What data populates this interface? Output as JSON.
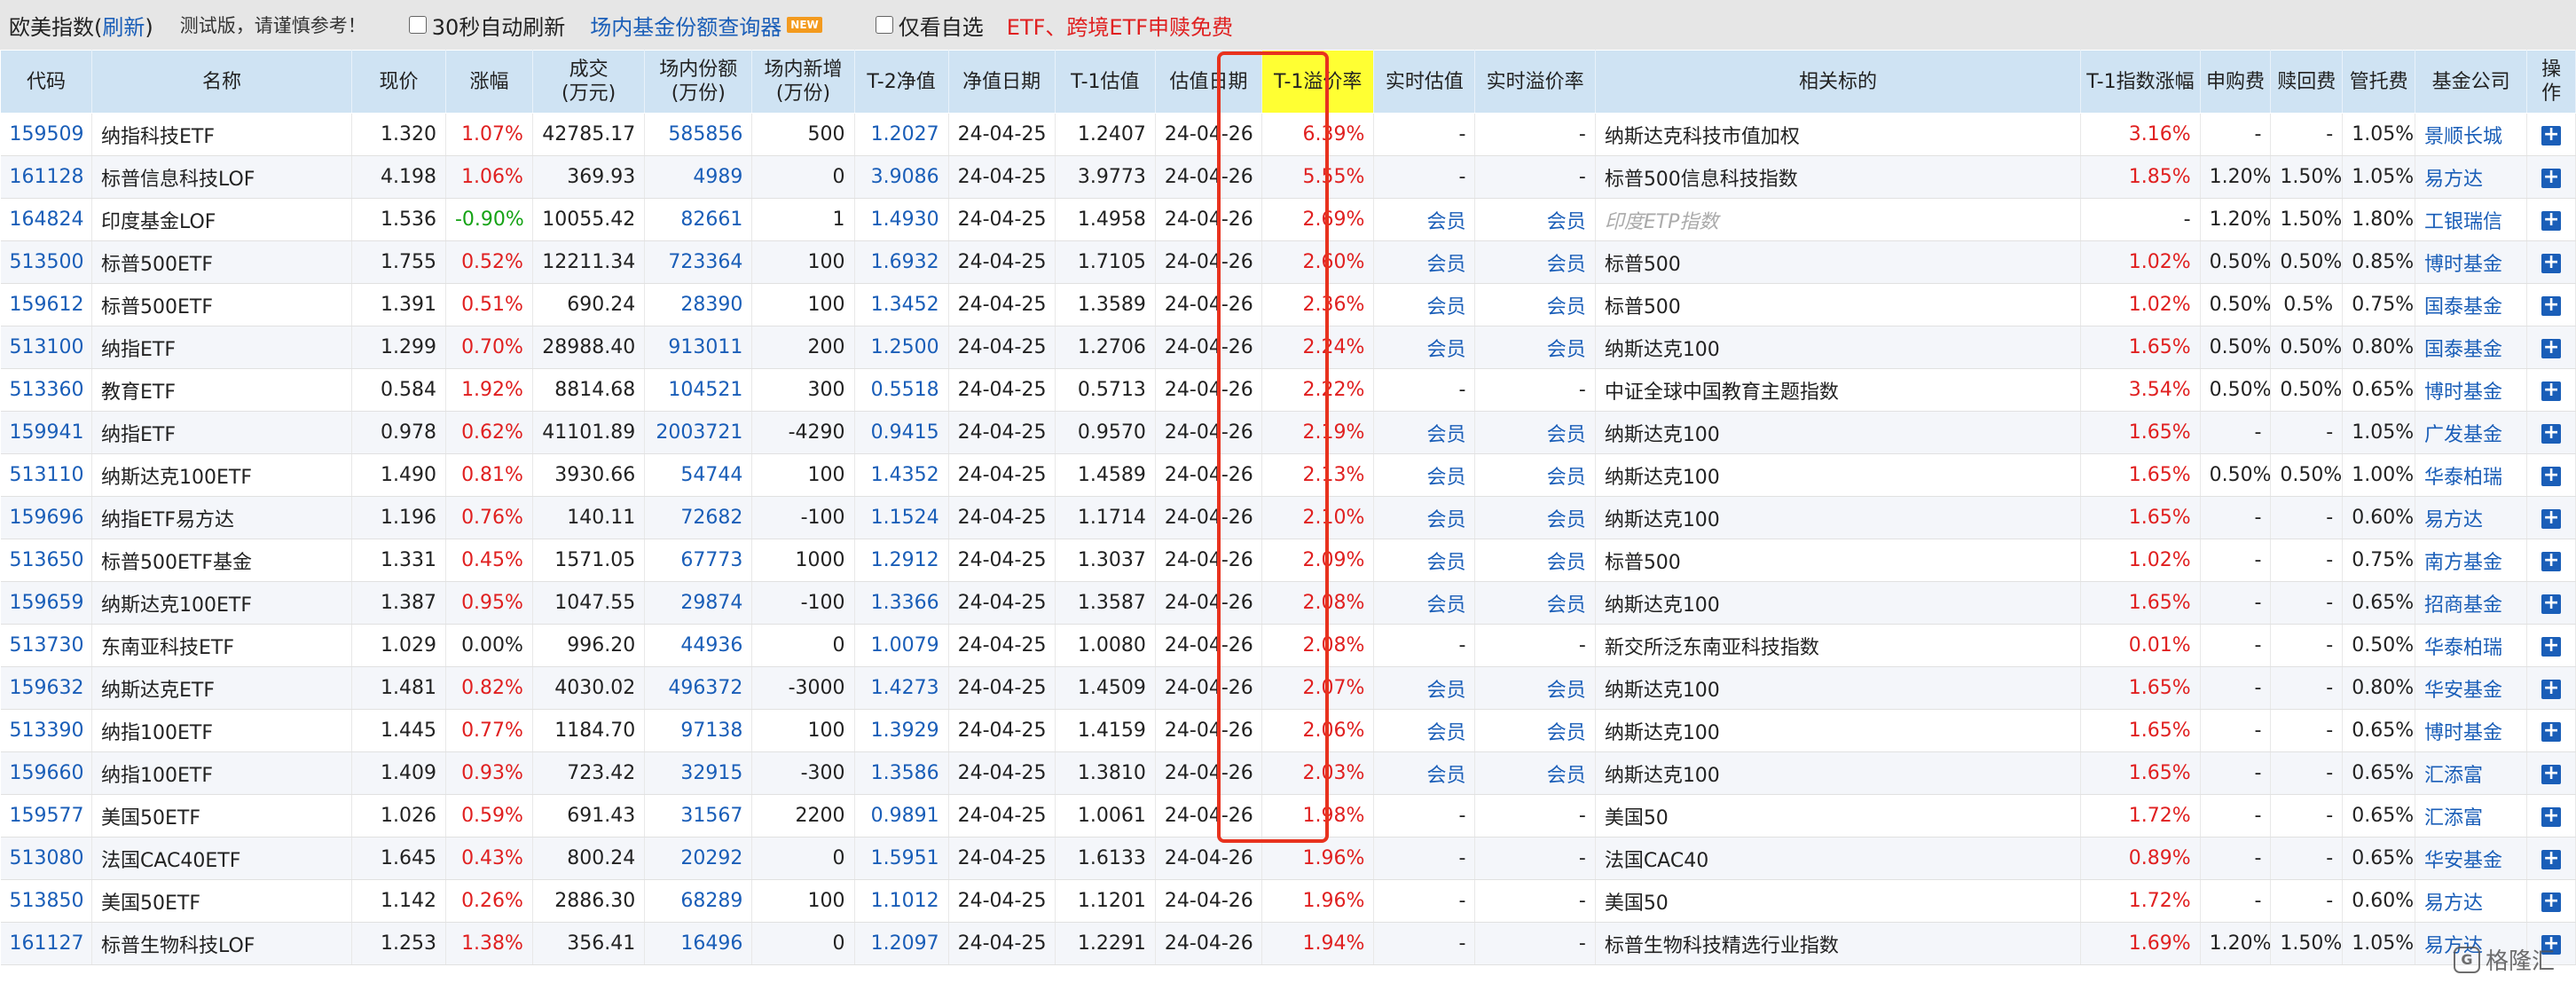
{
  "topbar": {
    "title": "欧美指数(",
    "refresh": "刷新",
    "title_end": ")",
    "note": "测试版，请谨慎参考！",
    "auto_refresh": "30秒自动刷新",
    "query_tool": "场内基金份额查询器",
    "new_badge": "NEW",
    "self_select": "仅看自选",
    "promo": "ETF、跨境ETF申赎免费"
  },
  "headers": [
    {
      "l1": "代码",
      "l2": ""
    },
    {
      "l1": "名称",
      "l2": ""
    },
    {
      "l1": "现价",
      "l2": ""
    },
    {
      "l1": "涨幅",
      "l2": ""
    },
    {
      "l1": "成交",
      "l2": "(万元)"
    },
    {
      "l1": "场内份额",
      "l2": "(万份)"
    },
    {
      "l1": "场内新增",
      "l2": "(万份)"
    },
    {
      "l1": "T-2净值",
      "l2": ""
    },
    {
      "l1": "净值日期",
      "l2": ""
    },
    {
      "l1": "T-1估值",
      "l2": ""
    },
    {
      "l1": "估值日期",
      "l2": ""
    },
    {
      "l1": "T-1溢价率",
      "l2": ""
    },
    {
      "l1": "实时估值",
      "l2": ""
    },
    {
      "l1": "实时溢价率",
      "l2": ""
    },
    {
      "l1": "相关标的",
      "l2": ""
    },
    {
      "l1": "T-1指数涨幅",
      "l2": ""
    },
    {
      "l1": "申购费",
      "l2": ""
    },
    {
      "l1": "赎回费",
      "l2": ""
    },
    {
      "l1": "管托费",
      "l2": ""
    },
    {
      "l1": "基金公司",
      "l2": ""
    },
    {
      "l1": "操",
      "l2": "作"
    }
  ],
  "rows": [
    {
      "code": "159509",
      "name": "纳指科技ETF",
      "price": "1.320",
      "chg": "1.07%",
      "chg_dir": "up",
      "vol": "42785.17",
      "shares": "585856",
      "new_shares": "500",
      "nav": "1.2027",
      "nav_date": "24-04-25",
      "est": "1.2407",
      "est_date": "24-04-26",
      "premium": "6.39%",
      "rt_est": "-",
      "rt_premium": "-",
      "index": "纳斯达克科技市值加权",
      "index_gray": false,
      "idx_chg": "3.16%",
      "buy_fee": "-",
      "sell_fee": "-",
      "mgmt_fee": "1.05%",
      "company": "景顺长城"
    },
    {
      "code": "161128",
      "name": "标普信息科技LOF",
      "price": "4.198",
      "chg": "1.06%",
      "chg_dir": "up",
      "vol": "369.93",
      "shares": "4989",
      "new_shares": "0",
      "nav": "3.9086",
      "nav_date": "24-04-25",
      "est": "3.9773",
      "est_date": "24-04-26",
      "premium": "5.55%",
      "rt_est": "-",
      "rt_premium": "-",
      "index": "标普500信息科技指数",
      "index_gray": false,
      "idx_chg": "1.85%",
      "buy_fee": "1.20%",
      "sell_fee": "1.50%",
      "mgmt_fee": "1.05%",
      "company": "易方达"
    },
    {
      "code": "164824",
      "name": "印度基金LOF",
      "price": "1.536",
      "chg": "-0.90%",
      "chg_dir": "down",
      "vol": "10055.42",
      "shares": "82661",
      "new_shares": "1",
      "nav": "1.4930",
      "nav_date": "24-04-25",
      "est": "1.4958",
      "est_date": "24-04-26",
      "premium": "2.69%",
      "rt_est": "会员",
      "rt_premium": "会员",
      "index": "印度ETP指数",
      "index_gray": true,
      "idx_chg": "-",
      "buy_fee": "1.20%",
      "sell_fee": "1.50%",
      "mgmt_fee": "1.80%",
      "company": "工银瑞信"
    },
    {
      "code": "513500",
      "name": "标普500ETF",
      "price": "1.755",
      "chg": "0.52%",
      "chg_dir": "up",
      "vol": "12211.34",
      "shares": "723364",
      "new_shares": "100",
      "nav": "1.6932",
      "nav_date": "24-04-25",
      "est": "1.7105",
      "est_date": "24-04-26",
      "premium": "2.60%",
      "rt_est": "会员",
      "rt_premium": "会员",
      "index": "标普500",
      "index_gray": false,
      "idx_chg": "1.02%",
      "buy_fee": "0.50%",
      "sell_fee": "0.50%",
      "mgmt_fee": "0.85%",
      "company": "博时基金"
    },
    {
      "code": "159612",
      "name": "标普500ETF",
      "price": "1.391",
      "chg": "0.51%",
      "chg_dir": "up",
      "vol": "690.24",
      "shares": "28390",
      "new_shares": "100",
      "nav": "1.3452",
      "nav_date": "24-04-25",
      "est": "1.3589",
      "est_date": "24-04-26",
      "premium": "2.36%",
      "rt_est": "会员",
      "rt_premium": "会员",
      "index": "标普500",
      "index_gray": false,
      "idx_chg": "1.02%",
      "buy_fee": "0.50%",
      "sell_fee": "0.5%",
      "mgmt_fee": "0.75%",
      "company": "国泰基金"
    },
    {
      "code": "513100",
      "name": "纳指ETF",
      "price": "1.299",
      "chg": "0.70%",
      "chg_dir": "up",
      "vol": "28988.40",
      "shares": "913011",
      "new_shares": "200",
      "nav": "1.2500",
      "nav_date": "24-04-25",
      "est": "1.2706",
      "est_date": "24-04-26",
      "premium": "2.24%",
      "rt_est": "会员",
      "rt_premium": "会员",
      "index": "纳斯达克100",
      "index_gray": false,
      "idx_chg": "1.65%",
      "buy_fee": "0.50%",
      "sell_fee": "0.50%",
      "mgmt_fee": "0.80%",
      "company": "国泰基金"
    },
    {
      "code": "513360",
      "name": "教育ETF",
      "price": "0.584",
      "chg": "1.92%",
      "chg_dir": "up",
      "vol": "8814.68",
      "shares": "104521",
      "new_shares": "300",
      "nav": "0.5518",
      "nav_date": "24-04-25",
      "est": "0.5713",
      "est_date": "24-04-26",
      "premium": "2.22%",
      "rt_est": "-",
      "rt_premium": "-",
      "index": "中证全球中国教育主题指数",
      "index_gray": false,
      "idx_chg": "3.54%",
      "buy_fee": "0.50%",
      "sell_fee": "0.50%",
      "mgmt_fee": "0.65%",
      "company": "博时基金"
    },
    {
      "code": "159941",
      "name": "纳指ETF",
      "price": "0.978",
      "chg": "0.62%",
      "chg_dir": "up",
      "vol": "41101.89",
      "shares": "2003721",
      "new_shares": "-4290",
      "nav": "0.9415",
      "nav_date": "24-04-25",
      "est": "0.9570",
      "est_date": "24-04-26",
      "premium": "2.19%",
      "rt_est": "会员",
      "rt_premium": "会员",
      "index": "纳斯达克100",
      "index_gray": false,
      "idx_chg": "1.65%",
      "buy_fee": "-",
      "sell_fee": "-",
      "mgmt_fee": "1.05%",
      "company": "广发基金"
    },
    {
      "code": "513110",
      "name": "纳斯达克100ETF",
      "price": "1.490",
      "chg": "0.81%",
      "chg_dir": "up",
      "vol": "3930.66",
      "shares": "54744",
      "new_shares": "100",
      "nav": "1.4352",
      "nav_date": "24-04-25",
      "est": "1.4589",
      "est_date": "24-04-26",
      "premium": "2.13%",
      "rt_est": "会员",
      "rt_premium": "会员",
      "index": "纳斯达克100",
      "index_gray": false,
      "idx_chg": "1.65%",
      "buy_fee": "0.50%",
      "sell_fee": "0.50%",
      "mgmt_fee": "1.00%",
      "company": "华泰柏瑞"
    },
    {
      "code": "159696",
      "name": "纳指ETF易方达",
      "price": "1.196",
      "chg": "0.76%",
      "chg_dir": "up",
      "vol": "140.11",
      "shares": "72682",
      "new_shares": "-100",
      "nav": "1.1524",
      "nav_date": "24-04-25",
      "est": "1.1714",
      "est_date": "24-04-26",
      "premium": "2.10%",
      "rt_est": "会员",
      "rt_premium": "会员",
      "index": "纳斯达克100",
      "index_gray": false,
      "idx_chg": "1.65%",
      "buy_fee": "-",
      "sell_fee": "-",
      "mgmt_fee": "0.60%",
      "company": "易方达"
    },
    {
      "code": "513650",
      "name": "标普500ETF基金",
      "price": "1.331",
      "chg": "0.45%",
      "chg_dir": "up",
      "vol": "1571.05",
      "shares": "67773",
      "new_shares": "1000",
      "nav": "1.2912",
      "nav_date": "24-04-25",
      "est": "1.3037",
      "est_date": "24-04-26",
      "premium": "2.09%",
      "rt_est": "会员",
      "rt_premium": "会员",
      "index": "标普500",
      "index_gray": false,
      "idx_chg": "1.02%",
      "buy_fee": "-",
      "sell_fee": "-",
      "mgmt_fee": "0.75%",
      "company": "南方基金"
    },
    {
      "code": "159659",
      "name": "纳斯达克100ETF",
      "price": "1.387",
      "chg": "0.95%",
      "chg_dir": "up",
      "vol": "1047.55",
      "shares": "29874",
      "new_shares": "-100",
      "nav": "1.3366",
      "nav_date": "24-04-25",
      "est": "1.3587",
      "est_date": "24-04-26",
      "premium": "2.08%",
      "rt_est": "会员",
      "rt_premium": "会员",
      "index": "纳斯达克100",
      "index_gray": false,
      "idx_chg": "1.65%",
      "buy_fee": "-",
      "sell_fee": "-",
      "mgmt_fee": "0.65%",
      "company": "招商基金"
    },
    {
      "code": "513730",
      "name": "东南亚科技ETF",
      "price": "1.029",
      "chg": "0.00%",
      "chg_dir": "flat",
      "vol": "996.20",
      "shares": "44936",
      "new_shares": "0",
      "nav": "1.0079",
      "nav_date": "24-04-25",
      "est": "1.0080",
      "est_date": "24-04-26",
      "premium": "2.08%",
      "rt_est": "-",
      "rt_premium": "-",
      "index": "新交所泛东南亚科技指数",
      "index_gray": false,
      "idx_chg": "0.01%",
      "buy_fee": "-",
      "sell_fee": "-",
      "mgmt_fee": "0.50%",
      "company": "华泰柏瑞"
    },
    {
      "code": "159632",
      "name": "纳斯达克ETF",
      "price": "1.481",
      "chg": "0.82%",
      "chg_dir": "up",
      "vol": "4030.02",
      "shares": "496372",
      "new_shares": "-3000",
      "nav": "1.4273",
      "nav_date": "24-04-25",
      "est": "1.4509",
      "est_date": "24-04-26",
      "premium": "2.07%",
      "rt_est": "会员",
      "rt_premium": "会员",
      "index": "纳斯达克100",
      "index_gray": false,
      "idx_chg": "1.65%",
      "buy_fee": "-",
      "sell_fee": "-",
      "mgmt_fee": "0.80%",
      "company": "华安基金"
    },
    {
      "code": "513390",
      "name": "纳指100ETF",
      "price": "1.445",
      "chg": "0.77%",
      "chg_dir": "up",
      "vol": "1184.70",
      "shares": "97138",
      "new_shares": "100",
      "nav": "1.3929",
      "nav_date": "24-04-25",
      "est": "1.4159",
      "est_date": "24-04-26",
      "premium": "2.06%",
      "rt_est": "会员",
      "rt_premium": "会员",
      "index": "纳斯达克100",
      "index_gray": false,
      "idx_chg": "1.65%",
      "buy_fee": "-",
      "sell_fee": "-",
      "mgmt_fee": "0.65%",
      "company": "博时基金"
    },
    {
      "code": "159660",
      "name": "纳指100ETF",
      "price": "1.409",
      "chg": "0.93%",
      "chg_dir": "up",
      "vol": "723.42",
      "shares": "32915",
      "new_shares": "-300",
      "nav": "1.3586",
      "nav_date": "24-04-25",
      "est": "1.3810",
      "est_date": "24-04-26",
      "premium": "2.03%",
      "rt_est": "会员",
      "rt_premium": "会员",
      "index": "纳斯达克100",
      "index_gray": false,
      "idx_chg": "1.65%",
      "buy_fee": "-",
      "sell_fee": "-",
      "mgmt_fee": "0.65%",
      "company": "汇添富"
    },
    {
      "code": "159577",
      "name": "美国50ETF",
      "price": "1.026",
      "chg": "0.59%",
      "chg_dir": "up",
      "vol": "691.43",
      "shares": "31567",
      "new_shares": "2200",
      "nav": "0.9891",
      "nav_date": "24-04-25",
      "est": "1.0061",
      "est_date": "24-04-26",
      "premium": "1.98%",
      "rt_est": "-",
      "rt_premium": "-",
      "index": "美国50",
      "index_gray": false,
      "idx_chg": "1.72%",
      "buy_fee": "-",
      "sell_fee": "-",
      "mgmt_fee": "0.65%",
      "company": "汇添富"
    },
    {
      "code": "513080",
      "name": "法国CAC40ETF",
      "price": "1.645",
      "chg": "0.43%",
      "chg_dir": "up",
      "vol": "800.24",
      "shares": "20292",
      "new_shares": "0",
      "nav": "1.5951",
      "nav_date": "24-04-25",
      "est": "1.6133",
      "est_date": "24-04-26",
      "premium": "1.96%",
      "rt_est": "-",
      "rt_premium": "-",
      "index": "法国CAC40",
      "index_gray": false,
      "idx_chg": "0.89%",
      "buy_fee": "-",
      "sell_fee": "-",
      "mgmt_fee": "0.65%",
      "company": "华安基金"
    },
    {
      "code": "513850",
      "name": "美国50ETF",
      "price": "1.142",
      "chg": "0.26%",
      "chg_dir": "up",
      "vol": "2886.30",
      "shares": "68289",
      "new_shares": "100",
      "nav": "1.1012",
      "nav_date": "24-04-25",
      "est": "1.1201",
      "est_date": "24-04-26",
      "premium": "1.96%",
      "rt_est": "-",
      "rt_premium": "-",
      "index": "美国50",
      "index_gray": false,
      "idx_chg": "1.72%",
      "buy_fee": "-",
      "sell_fee": "-",
      "mgmt_fee": "0.60%",
      "company": "易方达"
    },
    {
      "code": "161127",
      "name": "标普生物科技LOF",
      "price": "1.253",
      "chg": "1.38%",
      "chg_dir": "up",
      "vol": "356.41",
      "shares": "16496",
      "new_shares": "0",
      "nav": "1.2097",
      "nav_date": "24-04-25",
      "est": "1.2291",
      "est_date": "24-04-26",
      "premium": "1.94%",
      "rt_est": "-",
      "rt_premium": "-",
      "index": "标普生物科技精选行业指数",
      "index_gray": false,
      "idx_chg": "1.69%",
      "buy_fee": "1.20%",
      "sell_fee": "1.50%",
      "mgmt_fee": "1.05%",
      "company": "易方达"
    }
  ],
  "action_icon": "plus-icon",
  "action_glyph": "+",
  "watermark": {
    "logo_text": "G",
    "text": "格隆汇"
  },
  "colors": {
    "up": "#e02020",
    "down": "#16a316",
    "link": "#1a5eb8",
    "header": "#cfe3f3",
    "highlight": "#ffff33",
    "box": "#e8321e"
  }
}
